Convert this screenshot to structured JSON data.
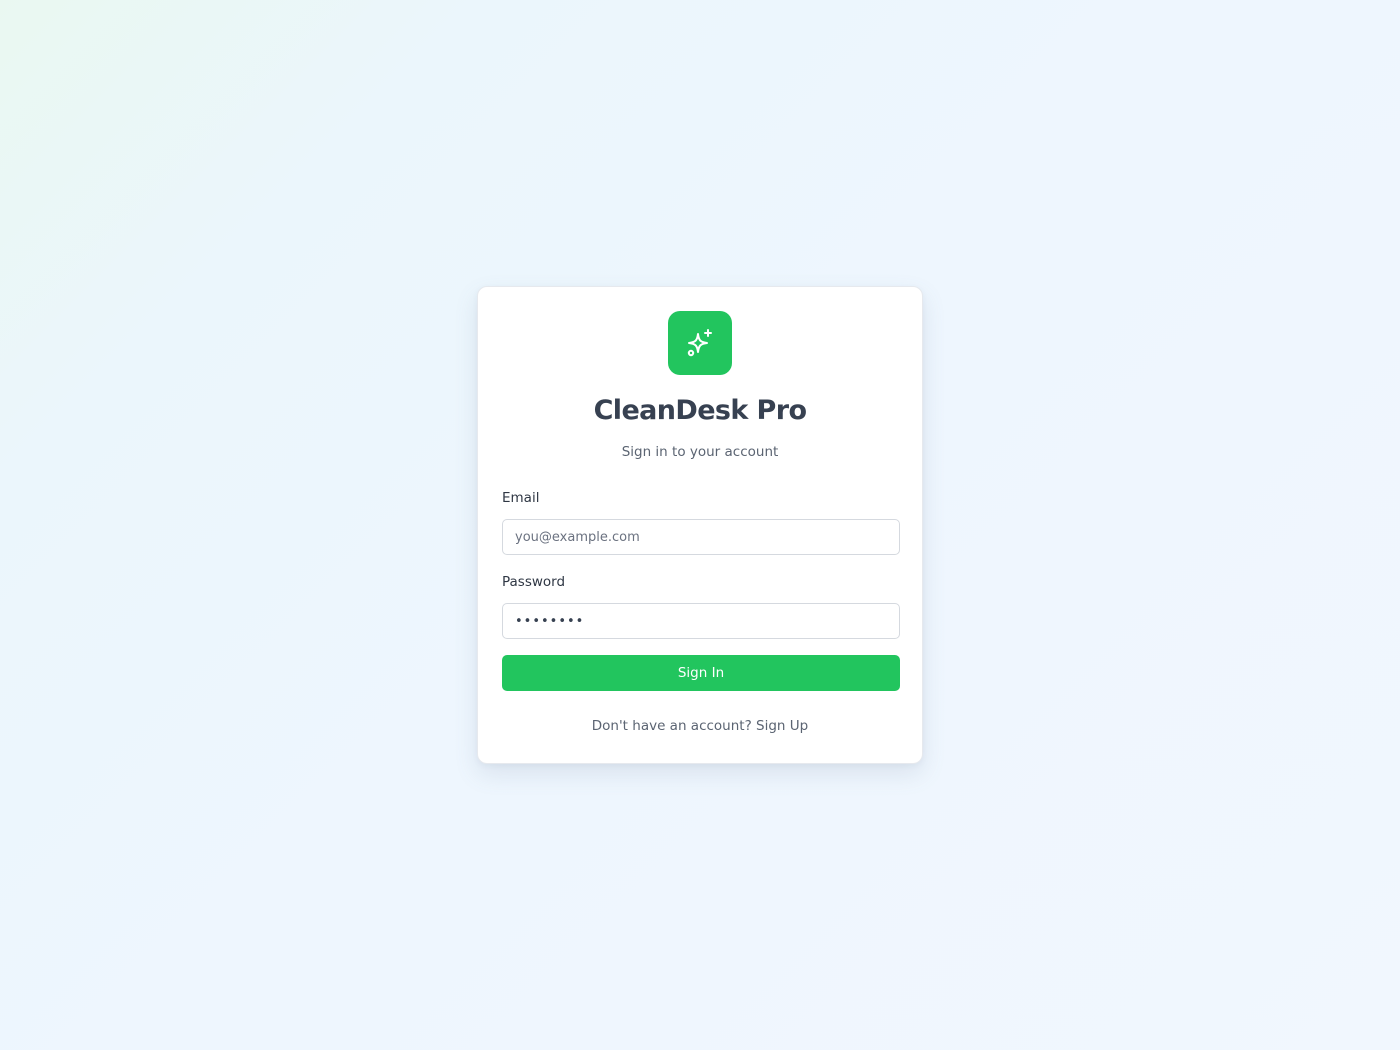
{
  "app": {
    "title": "CleanDesk Pro",
    "subtitle": "Sign in to your account",
    "logo_icon": "sparkles-icon",
    "accent_color": "#22c55e"
  },
  "form": {
    "email": {
      "label": "Email",
      "value": "",
      "placeholder": "you@example.com"
    },
    "password": {
      "label": "Password",
      "value": "password"
    },
    "submit_label": "Sign In"
  },
  "footer": {
    "prompt": "Don't have an account?",
    "link_label": "Sign Up"
  }
}
